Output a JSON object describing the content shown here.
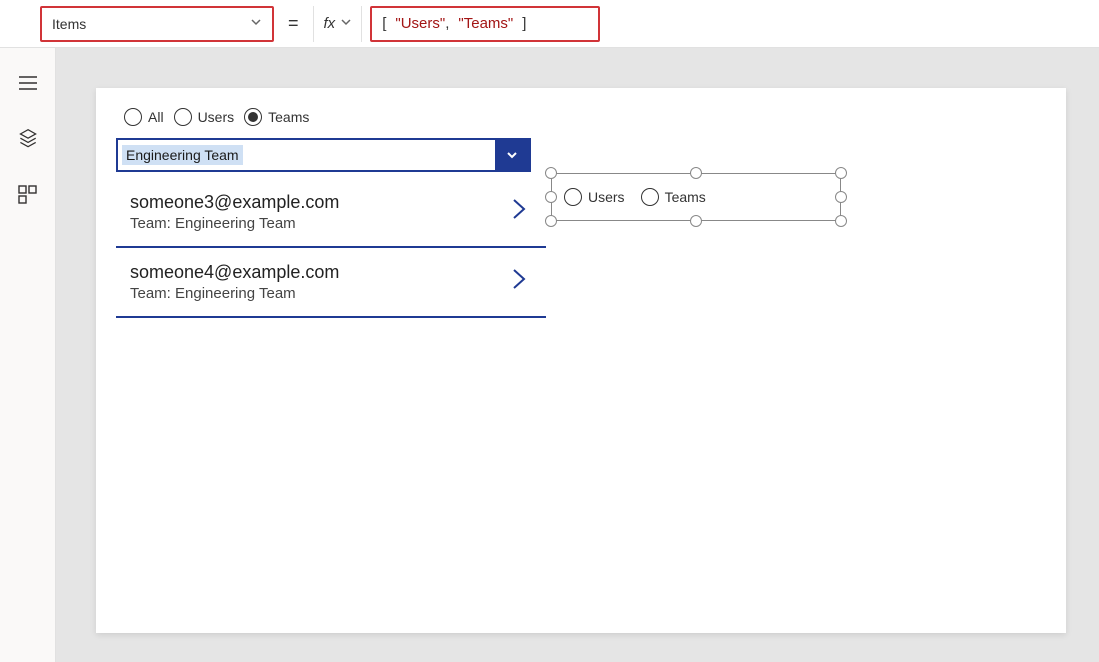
{
  "formula_bar": {
    "property": "Items",
    "equals": "=",
    "fx_label": "fx",
    "formula_tokens": {
      "lb": "[",
      "s1": "\"Users\"",
      "comma": ",",
      "s2": "\"Teams\"",
      "rb": "]"
    }
  },
  "left_rail": {
    "icons": [
      "hamburger-icon",
      "layers-icon",
      "components-icon"
    ]
  },
  "canvas": {
    "radio_group1": {
      "options": [
        {
          "label": "All",
          "selected": false
        },
        {
          "label": "Users",
          "selected": false
        },
        {
          "label": "Teams",
          "selected": true
        }
      ]
    },
    "combo": {
      "text": "Engineering Team"
    },
    "gallery": [
      {
        "title": "someone3@example.com",
        "sub": "Team: Engineering Team"
      },
      {
        "title": "someone4@example.com",
        "sub": "Team: Engineering Team"
      }
    ],
    "selected_radio_control": {
      "options": [
        {
          "label": "Users",
          "selected": false
        },
        {
          "label": "Teams",
          "selected": false
        }
      ]
    }
  }
}
